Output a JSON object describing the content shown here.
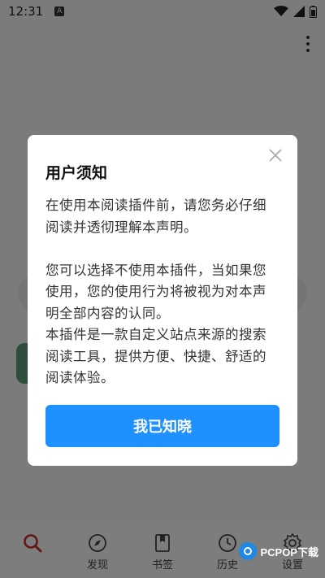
{
  "status_bar": {
    "time": "12:31",
    "badge": "A"
  },
  "bottom_nav": {
    "items": [
      {
        "label": ""
      },
      {
        "label": "发现"
      },
      {
        "label": "书签"
      },
      {
        "label": "历史"
      },
      {
        "label": "设置"
      }
    ]
  },
  "dialog": {
    "title": "用户须知",
    "body": "在使用本阅读插件前，请您务必仔细阅读并透彻理解本声明。\n\n您可以选择不使用本插件，当如果您使用，您的使用行为将被视为对本声明全部内容的认同。\n本插件是一款自定义站点来源的搜索阅读工具，提供方便、快捷、舒适的阅读体验。",
    "confirm_label": "我已知晓"
  },
  "watermark": {
    "text": "PCPOP下载"
  },
  "colors": {
    "accent": "#1e90ff",
    "active_nav": "#c62828"
  }
}
